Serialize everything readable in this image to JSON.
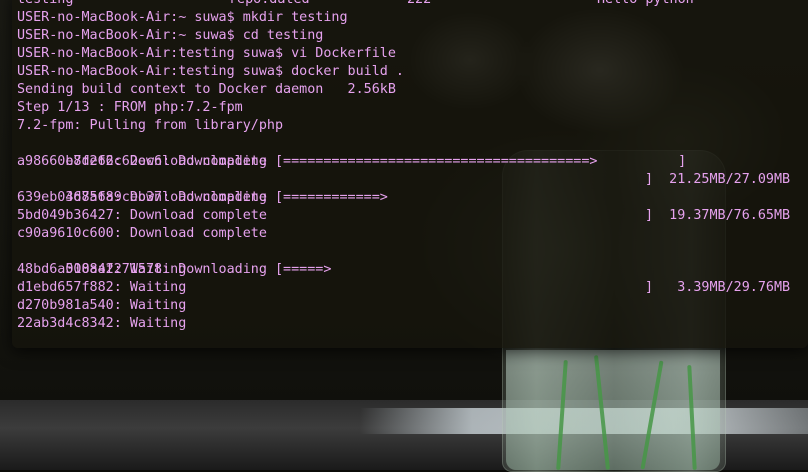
{
  "terminal": {
    "partial_top_line": [
      "testing",
      "repo.dated",
      "222",
      "Hello python"
    ],
    "lines": [
      "USER-no-MacBook-Air:~ suwa$ mkdir testing",
      "USER-no-MacBook-Air:~ suwa$ cd testing",
      "USER-no-MacBook-Air:testing suwa$ vi Dockerfile",
      "USER-no-MacBook-Air:testing suwa$ docker build .",
      "Sending build context to Docker daemon   2.56kB",
      "Step 1/13 : FROM php:7.2-fpm",
      "7.2-fpm: Pulling from library/php"
    ],
    "layers": [
      {
        "id": "b8f262c62ec6",
        "text": "b8f262c62ec6: Downloading [======================================>          ]",
        "tail": "]  21.25MB/27.09MB",
        "progress_fraction": 0.78
      },
      {
        "id": "a98660e7def6",
        "text": "a98660e7def6: Download complete",
        "tail": ""
      },
      {
        "id": "4d75689ceb37",
        "text": "4d75689ceb37: Downloading [============>",
        "tail": "]  19.37MB/76.65MB",
        "progress_fraction": 0.25
      },
      {
        "id": "639eb0368afa",
        "text": "639eb0368afa: Download complete",
        "tail": ""
      },
      {
        "id": "5bd049b36427",
        "text": "5bd049b36427: Download complete",
        "tail": ""
      },
      {
        "id": "c90a9610c600",
        "text": "c90a9610c600: Download complete",
        "tail": ""
      },
      {
        "id": "508a42271578",
        "text": "508a42271578: Downloading [=====>",
        "tail": "]   3.39MB/29.76MB",
        "progress_fraction": 0.11
      },
      {
        "id": "48bd6a0108af",
        "text": "48bd6a0108af: Waiting",
        "tail": ""
      },
      {
        "id": "d1ebd657f882",
        "text": "d1ebd657f882: Waiting",
        "tail": ""
      },
      {
        "id": "d270b981a540",
        "text": "d270b981a540: Waiting",
        "tail": ""
      },
      {
        "id": "22ab3d4c8342",
        "text": "22ab3d4c8342: Waiting",
        "tail": ""
      }
    ],
    "text_color": "#e6a2ee",
    "background_color": "#16140c"
  }
}
